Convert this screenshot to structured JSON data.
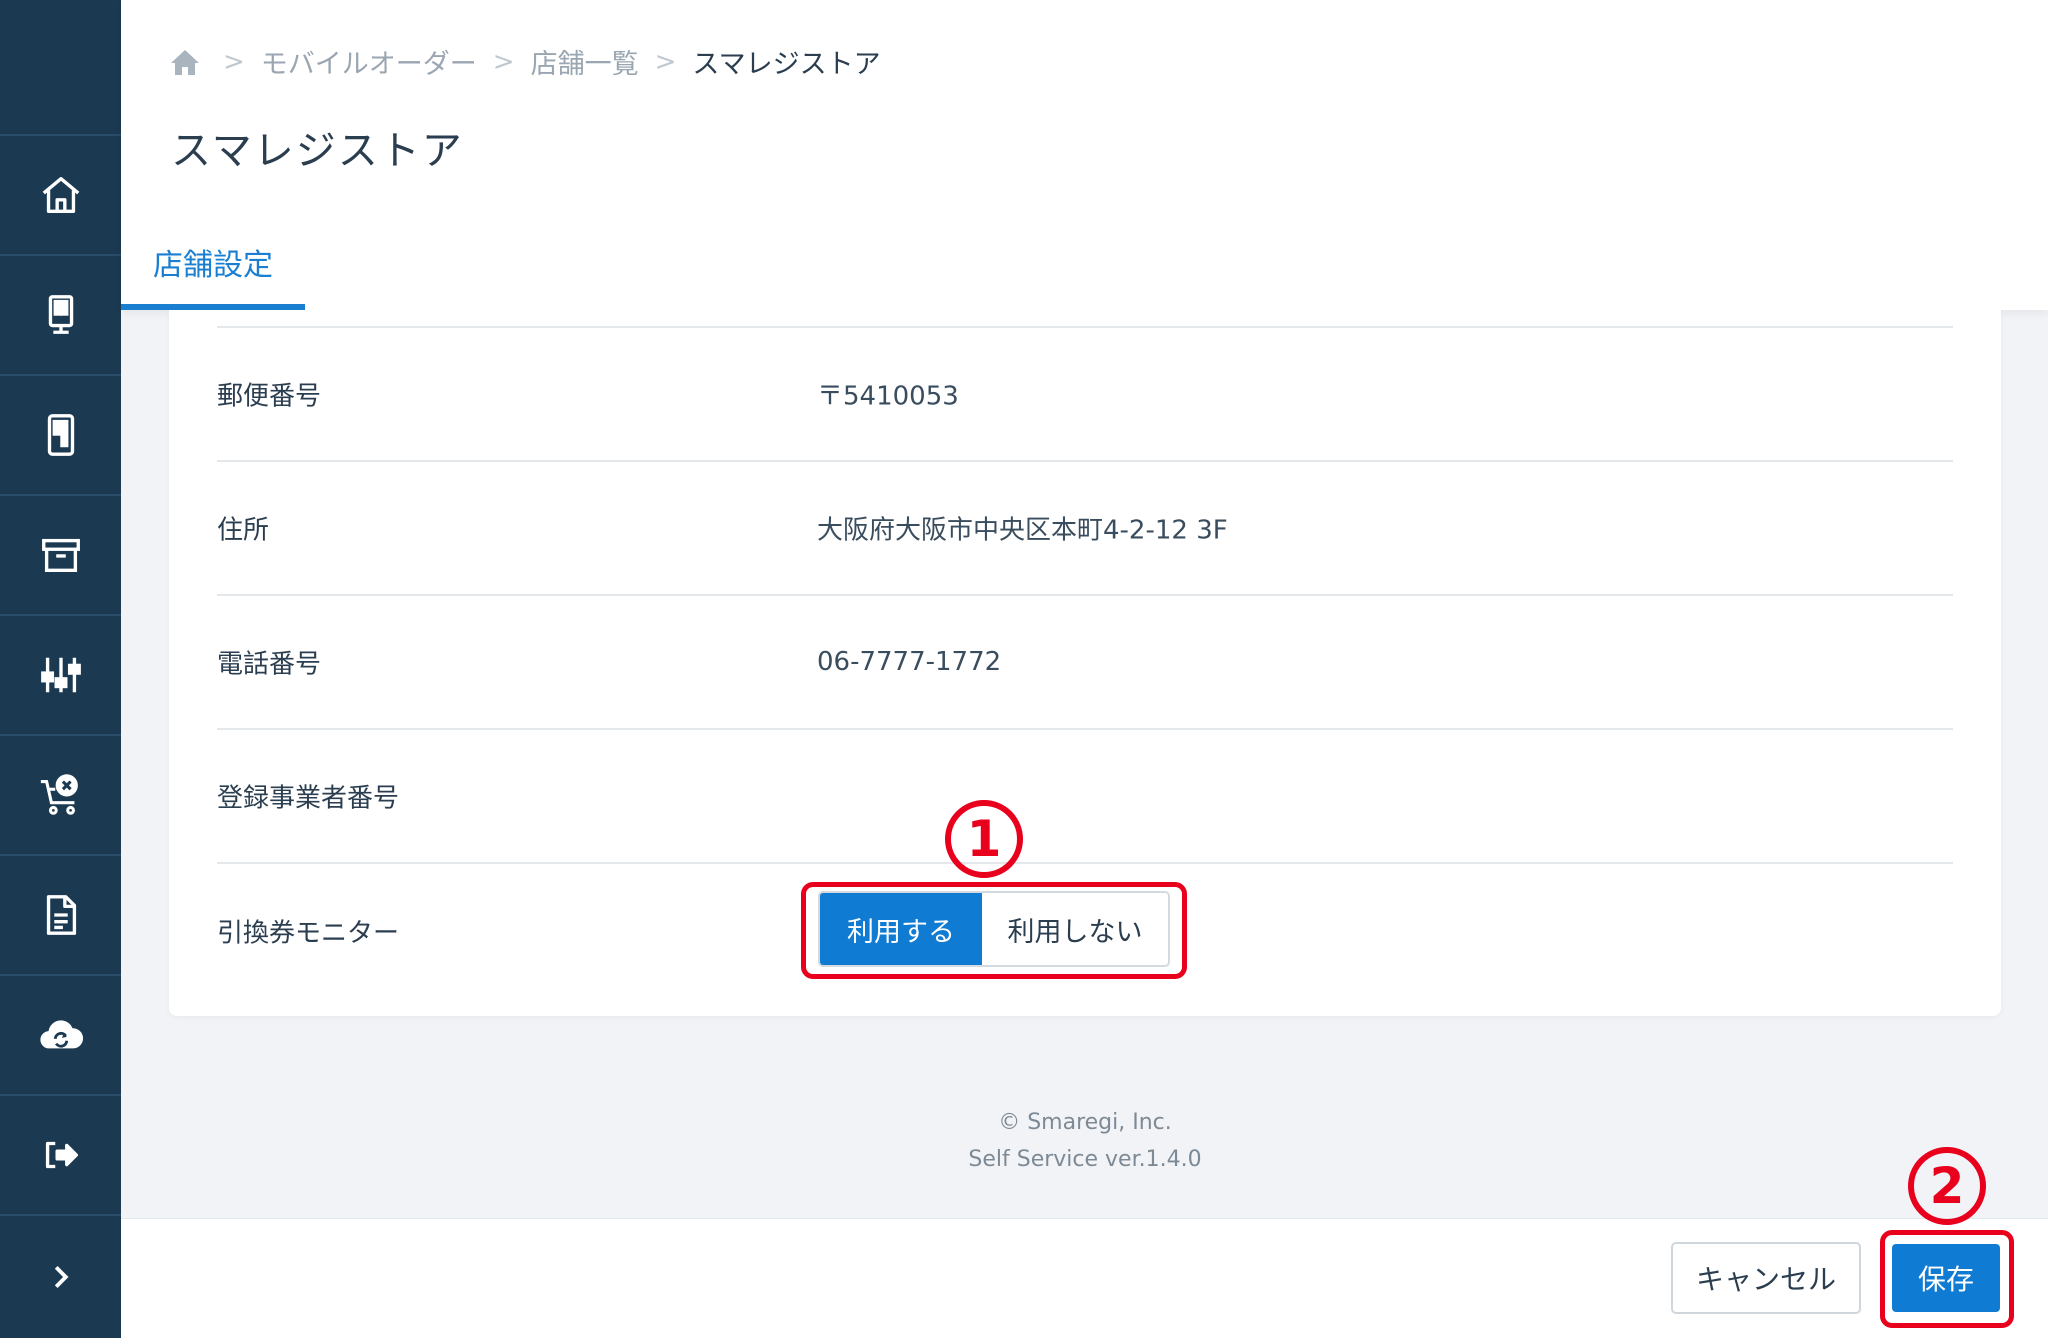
{
  "sidebar": {
    "items": [
      {
        "icon": "home-icon"
      },
      {
        "icon": "kiosk-icon"
      },
      {
        "icon": "tablet-icon"
      },
      {
        "icon": "archive-icon"
      },
      {
        "icon": "sliders-icon"
      },
      {
        "icon": "cart-cancel-icon"
      },
      {
        "icon": "document-icon"
      },
      {
        "icon": "cloud-sync-icon"
      },
      {
        "icon": "logout-icon"
      },
      {
        "icon": "chevron-right-icon"
      }
    ]
  },
  "breadcrumb": {
    "items": [
      "モバイルオーダー",
      "店舗一覧"
    ],
    "current": "スマレジストア"
  },
  "page": {
    "title": "スマレジストア",
    "tab": "店舗設定"
  },
  "settings": {
    "rows": [
      {
        "label": "郵便番号",
        "value": "〒5410053"
      },
      {
        "label": "住所",
        "value": "大阪府大阪市中央区本町4-2-12 3F"
      },
      {
        "label": "電話番号",
        "value": "06-7777-1772"
      },
      {
        "label": "登録事業者番号",
        "value": ""
      },
      {
        "label": "引換券モニター",
        "value": ""
      }
    ],
    "toggle": {
      "on_label": "利用する",
      "off_label": "利用しない",
      "selected": "利用する"
    }
  },
  "footer": {
    "copyright": "© Smaregi, Inc.",
    "version": "Self Service ver.1.4.0"
  },
  "actions": {
    "cancel": "キャンセル",
    "save": "保存"
  },
  "annotations": {
    "step1": "1",
    "step2": "2"
  },
  "colors": {
    "sidebar": "#1b3a52",
    "accent": "#0f7bd3",
    "annotation": "#e8001c"
  }
}
